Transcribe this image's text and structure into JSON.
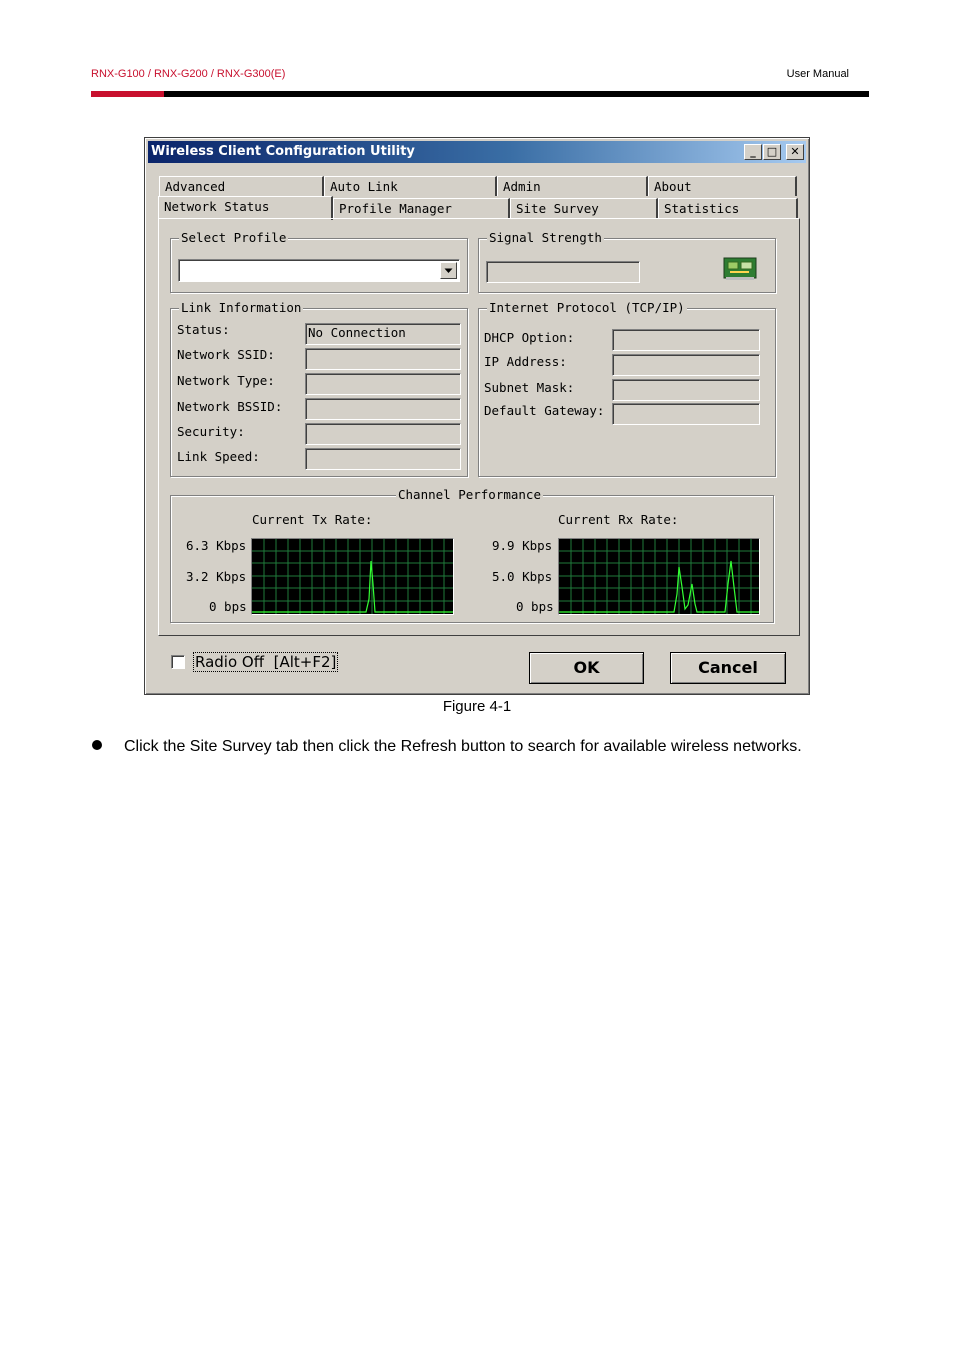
{
  "header": {
    "models": "RNX-G100  /  RNX-G200  /  RNX-G300(E)",
    "doc_type": "User  Manual"
  },
  "dialog": {
    "title": "Wireless Client Configuration Utility",
    "controls": {
      "minimize": "_",
      "maximize": "□",
      "close": "✕"
    },
    "tabs_back": [
      "Advanced",
      "Auto Link",
      "Admin",
      "About"
    ],
    "tabs_front": [
      "Network Status",
      "Profile Manager",
      "Site Survey",
      "Statistics"
    ],
    "active_tab": "Network Status",
    "select_profile": {
      "title": "Select Profile",
      "value": ""
    },
    "signal_strength": {
      "title": "Signal Strength",
      "value": ""
    },
    "link_information": {
      "title": "Link Information",
      "rows": [
        {
          "label": "Status:",
          "value": "No Connection"
        },
        {
          "label": "Network SSID:",
          "value": ""
        },
        {
          "label": "Network Type:",
          "value": ""
        },
        {
          "label": "Network BSSID:",
          "value": ""
        },
        {
          "label": "Security:",
          "value": ""
        },
        {
          "label": "Link Speed:",
          "value": ""
        }
      ]
    },
    "internet_protocol": {
      "title": "Internet Protocol (TCP/IP)",
      "rows": [
        {
          "label": "DHCP Option:",
          "value": ""
        },
        {
          "label": "IP Address:",
          "value": ""
        },
        {
          "label": "Subnet Mask:",
          "value": ""
        },
        {
          "label": "Default Gateway:",
          "value": ""
        }
      ]
    },
    "channel_performance": {
      "title": "Channel Performance",
      "tx": {
        "title": "Current Tx Rate:",
        "max": "6.3 Kbps",
        "mid": "3.2 Kbps",
        "zero": "0 bps"
      },
      "rx": {
        "title": "Current Rx Rate:",
        "max": "9.9 Kbps",
        "mid": "5.0 Kbps",
        "zero": "0 bps"
      }
    },
    "radio_off_label": "Radio Off  [Alt+F2]",
    "radio_off_checked": false,
    "ok_label": "OK",
    "cancel_label": "Cancel"
  },
  "figure_caption": "Figure 4-1",
  "instruction": "Click the Site Survey tab then click the Refresh button to search for available wireless networks."
}
